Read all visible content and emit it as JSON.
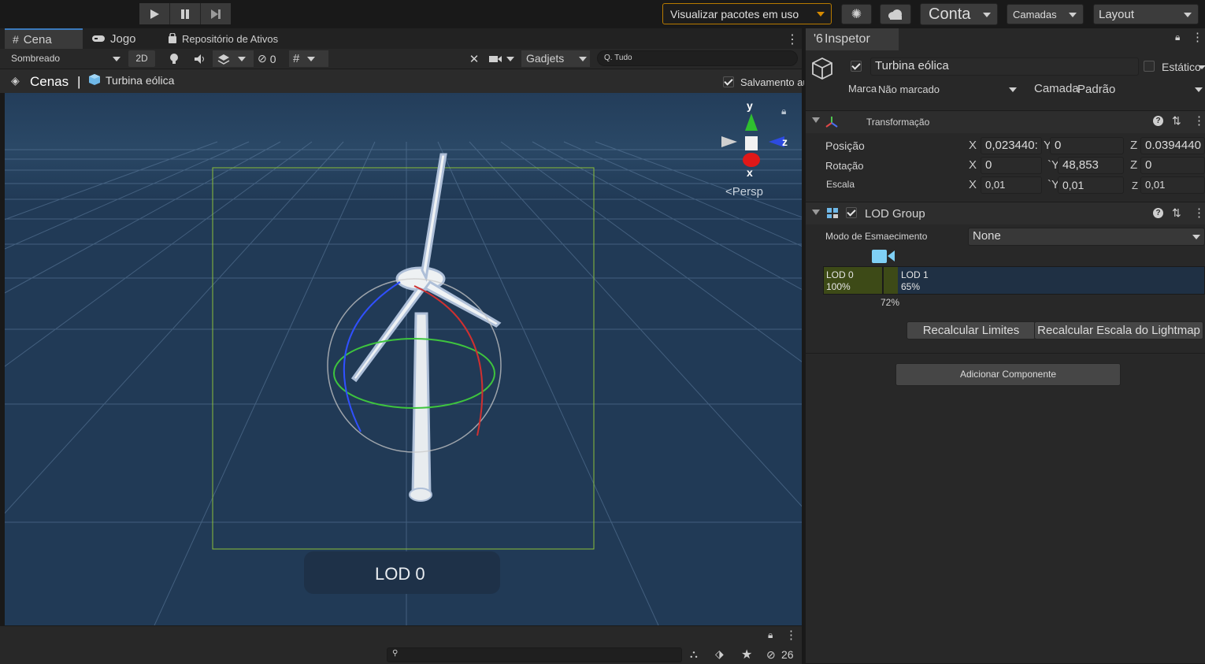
{
  "toolbar": {
    "packages_label": "Visualizar pacotes em uso",
    "account_label": "Conta",
    "layers_label": "Camadas",
    "layout_label": "Layout"
  },
  "scene_tabs": {
    "scene": "Cena",
    "game": "Jogo",
    "asset_store": "Repositório de Ativos"
  },
  "scene_toolbar": {
    "shading": "Sombreado",
    "mode_2d": "2D",
    "hidden_count": "0",
    "gizmos": "Gadjets",
    "search_placeholder": "Q. Tudo"
  },
  "breadcrumb": {
    "root": "Cenas",
    "separator": "|",
    "item": "Turbina eólica",
    "autosave": "Salvamento automático"
  },
  "viewport": {
    "axis_y": "y",
    "axis_z": "z",
    "axis_x": "x",
    "projection": "<Persp",
    "lod_overlay": "LOD 0"
  },
  "bottom_bar": {
    "hidden_count": "26"
  },
  "inspector": {
    "tab_title": "Inspetor",
    "tab_prefix": "'6",
    "object_name": "Turbina eólica",
    "static_label": "Estático",
    "tag_label": "Marca",
    "tag_value": "Não marcado",
    "layer_label": "Camada",
    "layer_value": "Padrão",
    "transform": {
      "title": "Transformação",
      "position_label": "Posição",
      "rotation_label": "Rotação",
      "scale_label": "Escala",
      "pos_x": "0,023440:",
      "pos_y": "0",
      "pos_z": "0.0394440",
      "rot_x": "0",
      "rot_y": "48,853",
      "rot_z": "0",
      "scale_x": "0,01",
      "scale_y": "0,01",
      "scale_z": "0,01",
      "x": "X",
      "y": "Y",
      "z": "Z",
      "y_alt": "`Y",
      "z_alt": "Z"
    },
    "lod_group": {
      "title": "LOD Group",
      "fade_label": "Modo de Esmaecimento",
      "fade_value": "None",
      "lod0_name": "LOD 0",
      "lod0_pct": "100%",
      "lod1_name": "LOD 1",
      "lod1_pct": "65%",
      "marker_pct": "72%",
      "recalc_bounds": "Recalcular Limites",
      "recalc_lightmap": "Recalcular Escala do Lightmap"
    },
    "add_component": "Adicionar Componente"
  },
  "colors": {
    "viewport_bg": "#213a56",
    "lod0": "#3d4a17",
    "lod1": "#1f3044",
    "accent_orange": "#b77a00"
  }
}
